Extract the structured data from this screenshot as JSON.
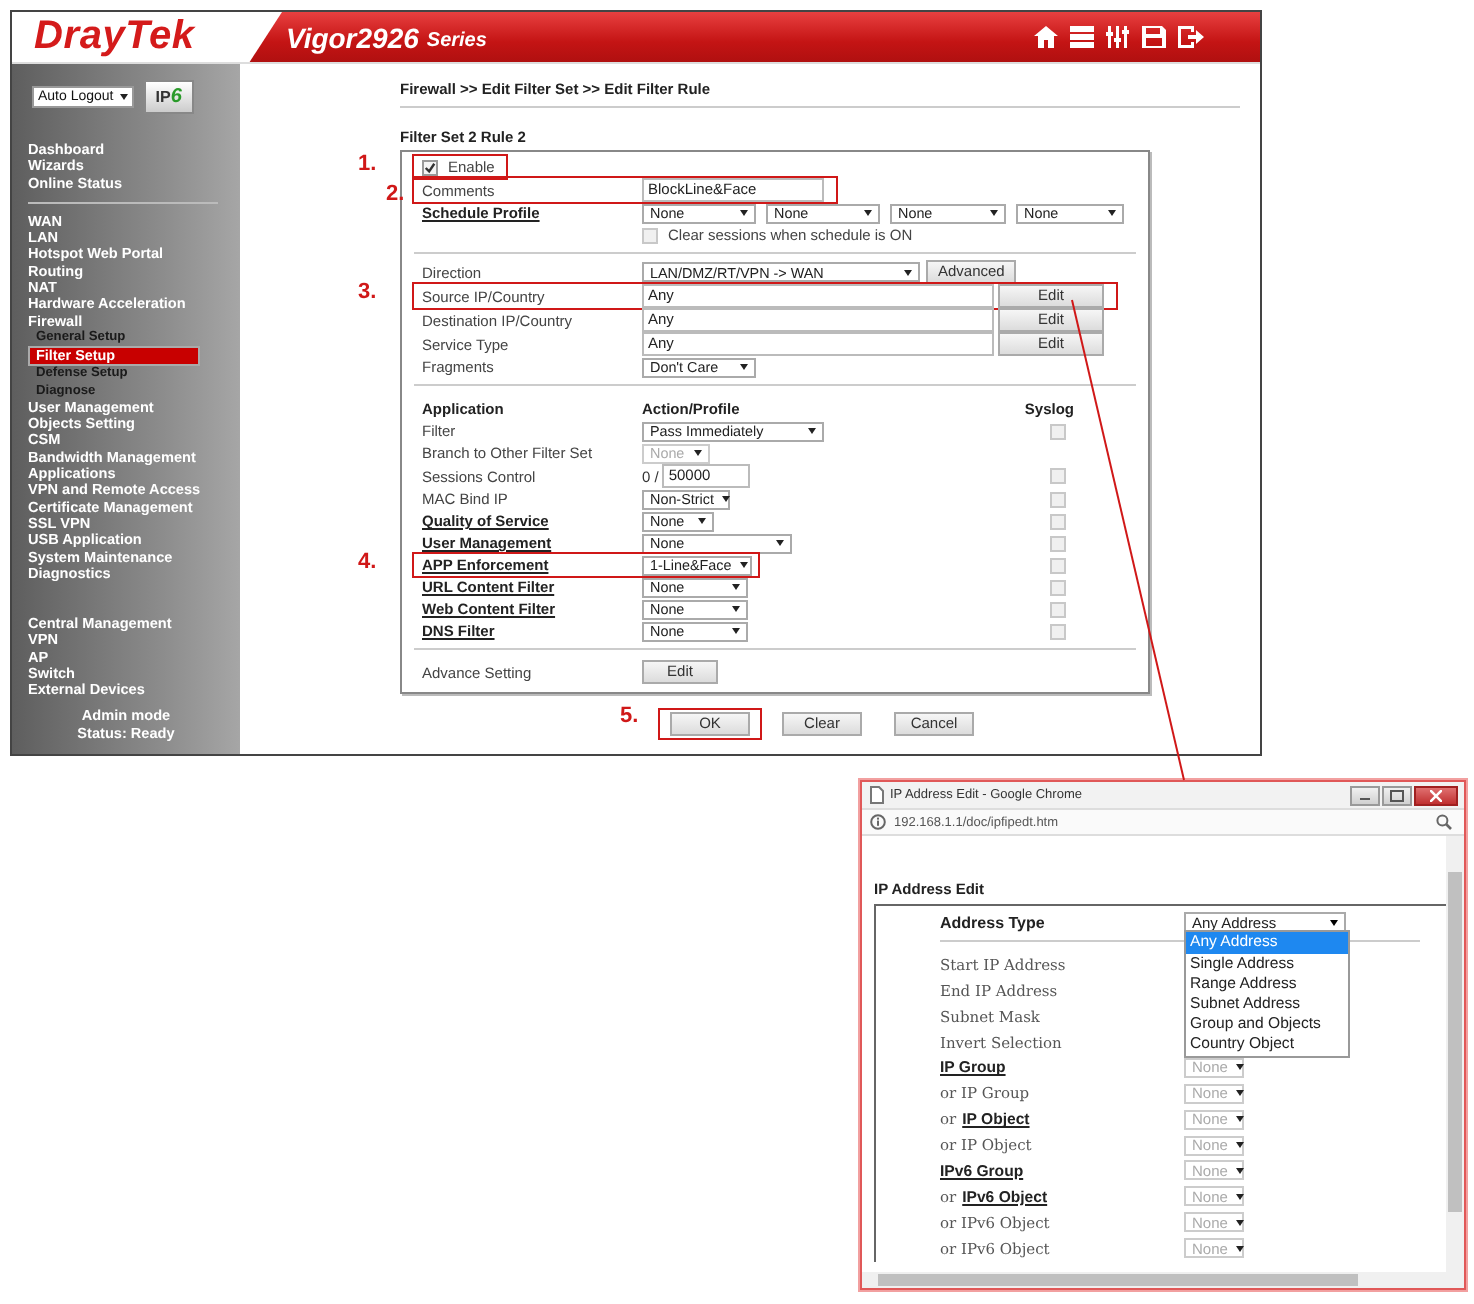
{
  "header": {
    "logo": "DrayTek",
    "model": "Vigor2926",
    "series": "Series"
  },
  "sidebar": {
    "auto_logout": "Auto Logout",
    "ip_badge": {
      "text": "IP",
      "digit": "6"
    },
    "groups": [
      [
        {
          "label": "Dashboard",
          "selected": false
        },
        {
          "label": "Wizards",
          "selected": false
        },
        {
          "label": "Online Status",
          "selected": false
        }
      ],
      [
        {
          "label": "WAN",
          "selected": false
        },
        {
          "label": "LAN",
          "selected": false
        },
        {
          "label": "Hotspot Web Portal",
          "selected": false
        },
        {
          "label": "Routing",
          "selected": false
        },
        {
          "label": "NAT",
          "selected": false
        },
        {
          "label": "Hardware Acceleration",
          "selected": false
        },
        {
          "label": "Firewall",
          "selected": false,
          "children": [
            {
              "label": "General Setup",
              "selected": false
            },
            {
              "label": "Filter Setup",
              "selected": true
            },
            {
              "label": "Defense Setup",
              "selected": false
            },
            {
              "label": "Diagnose",
              "selected": false
            }
          ]
        },
        {
          "label": "User Management",
          "selected": false
        },
        {
          "label": "Objects Setting",
          "selected": false
        },
        {
          "label": "CSM",
          "selected": false
        },
        {
          "label": "Bandwidth Management",
          "selected": false
        },
        {
          "label": "Applications",
          "selected": false
        },
        {
          "label": "VPN and Remote Access",
          "selected": false
        },
        {
          "label": "Certificate Management",
          "selected": false
        },
        {
          "label": "SSL VPN",
          "selected": false
        },
        {
          "label": "USB Application",
          "selected": false
        },
        {
          "label": "System Maintenance",
          "selected": false
        },
        {
          "label": "Diagnostics",
          "selected": false
        }
      ],
      [
        {
          "label": "Central Management",
          "selected": false
        },
        {
          "label": "VPN",
          "selected": false
        },
        {
          "label": "AP",
          "selected": false
        },
        {
          "label": "Switch",
          "selected": false
        },
        {
          "label": "External Devices",
          "selected": false
        }
      ]
    ],
    "status": [
      "Admin mode",
      "Status: Ready"
    ]
  },
  "breadcrumb": "Firewall >> Edit Filter Set >> Edit Filter Rule",
  "form": {
    "title": "Filter Set 2 Rule 2",
    "enable": {
      "label": "Enable",
      "checked": true,
      "marker": "1.",
      "highlighted": true
    },
    "comments": {
      "label": "Comments",
      "value": "BlockLine&Face",
      "marker": "2.",
      "highlighted": true
    },
    "schedule": {
      "label": "Schedule Profile",
      "profiles": [
        "None",
        "None",
        "None",
        "None"
      ],
      "clear_sessions": {
        "label": "Clear sessions when schedule is ON",
        "checked": false
      }
    },
    "addressing": [
      {
        "kind": "select",
        "label": "Direction",
        "value": "LAN/DMZ/RT/VPN -> WAN",
        "button": "Advanced",
        "highlighted": false
      },
      {
        "kind": "field",
        "label": "Source IP/Country",
        "value": "Any",
        "button": "Edit",
        "marker": "3.",
        "highlighted": true
      },
      {
        "kind": "field",
        "label": "Destination IP/Country",
        "value": "Any",
        "button": "Edit",
        "highlighted": false
      },
      {
        "kind": "field",
        "label": "Service Type",
        "value": "Any",
        "button": "Edit",
        "highlighted": false
      },
      {
        "kind": "select",
        "label": "Fragments",
        "value": "Don't Care",
        "highlighted": false
      }
    ],
    "application": {
      "columns": [
        "Application",
        "Action/Profile",
        "Syslog"
      ],
      "rows": [
        {
          "kind": "select",
          "label": "Filter",
          "link": false,
          "value": "Pass Immediately",
          "disabled": false,
          "syslog": {
            "checked": false
          },
          "highlighted": false
        },
        {
          "kind": "select",
          "label": "Branch to Other Filter Set",
          "link": false,
          "value": "None",
          "disabled": true,
          "highlighted": false
        },
        {
          "kind": "sessions",
          "label": "Sessions Control",
          "link": false,
          "prefix": "0 /",
          "value": "50000",
          "syslog": {
            "checked": false
          },
          "highlighted": false
        },
        {
          "kind": "select",
          "label": "MAC Bind IP",
          "link": false,
          "value": "Non-Strict",
          "disabled": false,
          "syslog": {
            "checked": false
          },
          "highlighted": false
        },
        {
          "kind": "select",
          "label": "Quality of Service",
          "link": true,
          "value": "None",
          "disabled": false,
          "syslog": {
            "checked": false
          },
          "highlighted": false
        },
        {
          "kind": "select",
          "label": "User Management",
          "link": true,
          "value": "None",
          "disabled": false,
          "syslog": {
            "checked": false
          },
          "highlighted": false
        },
        {
          "kind": "select",
          "label": "APP Enforcement",
          "link": true,
          "value": "1-Line&Face",
          "disabled": false,
          "syslog": {
            "checked": false
          },
          "marker": "4.",
          "highlighted": true
        },
        {
          "kind": "select",
          "label": "URL Content Filter",
          "link": true,
          "value": "None",
          "disabled": false,
          "syslog": {
            "checked": false
          },
          "highlighted": false
        },
        {
          "kind": "select",
          "label": "Web Content Filter",
          "link": true,
          "value": "None",
          "disabled": false,
          "syslog": {
            "checked": false
          },
          "highlighted": false
        },
        {
          "kind": "select",
          "label": "DNS Filter",
          "link": true,
          "value": "None",
          "disabled": false,
          "syslog": {
            "checked": false
          },
          "highlighted": false
        }
      ]
    },
    "advance": {
      "label": "Advance Setting",
      "button": "Edit"
    }
  },
  "buttons": [
    {
      "label": "OK",
      "marker": "5.",
      "highlighted": true
    },
    {
      "label": "Clear",
      "highlighted": false
    },
    {
      "label": "Cancel",
      "highlighted": false
    }
  ],
  "popup": {
    "title": "IP Address Edit - Google Chrome",
    "url": "192.168.1.1/doc/ipfipedt.htm",
    "heading": "IP Address Edit",
    "address_type": {
      "label": "Address Type",
      "value": "Any Address",
      "expanded": true,
      "options": [
        {
          "label": "Any Address",
          "selected": true
        },
        {
          "label": "Single Address",
          "selected": false
        },
        {
          "label": "Range Address",
          "selected": false
        },
        {
          "label": "Subnet Address",
          "selected": false
        },
        {
          "label": "Group and Objects",
          "selected": false
        },
        {
          "label": "Country Object",
          "selected": false
        }
      ]
    },
    "fields": [
      {
        "kind": "plain",
        "label": "Start IP Address"
      },
      {
        "kind": "plain",
        "label": "End IP Address"
      },
      {
        "kind": "plain",
        "label": "Subnet Mask"
      },
      {
        "kind": "plain",
        "label": "Invert Selection"
      },
      {
        "kind": "select",
        "label": "IP Group",
        "link": true,
        "value": "None"
      },
      {
        "kind": "select",
        "label": "or IP Group",
        "link": false,
        "value": "None"
      },
      {
        "kind": "select",
        "prefix": "or",
        "label": "IP Object",
        "link": true,
        "value": "None"
      },
      {
        "kind": "select",
        "label": "or IP Object",
        "link": false,
        "value": "None"
      },
      {
        "kind": "select",
        "label": "IPv6 Group",
        "link": true,
        "value": "None"
      },
      {
        "kind": "select",
        "prefix": "or",
        "label": "IPv6 Object",
        "link": true,
        "value": "None"
      },
      {
        "kind": "select",
        "label": "or IPv6 Object",
        "link": false,
        "value": "None"
      },
      {
        "kind": "select",
        "label": "or IPv6 Object",
        "link": false,
        "value": "None"
      }
    ]
  }
}
